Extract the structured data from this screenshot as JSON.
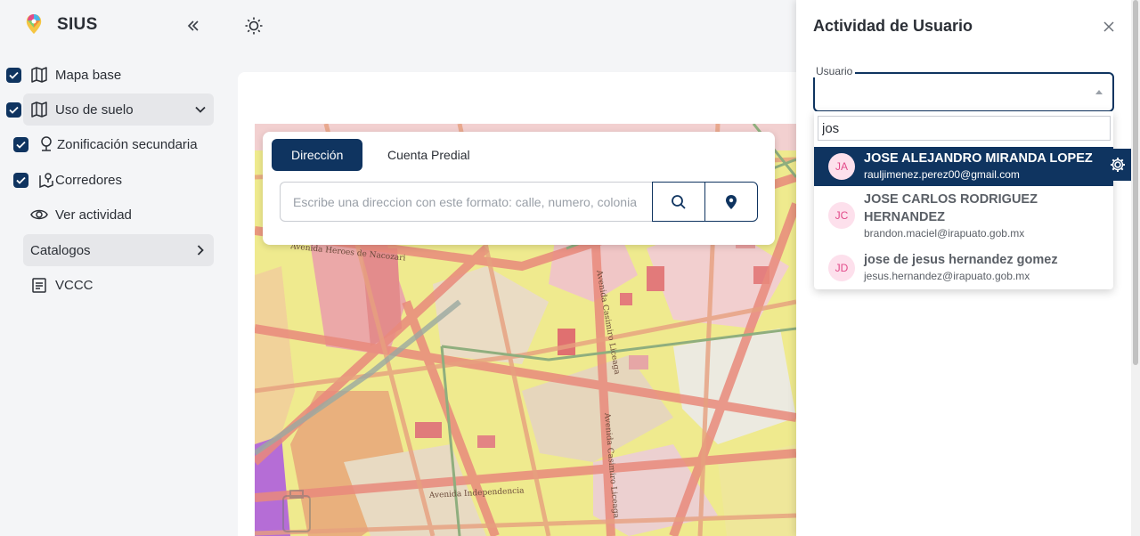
{
  "app": {
    "name": "SIUS"
  },
  "sidebar": {
    "items": [
      {
        "label": "Mapa base",
        "checked": true,
        "icon": "map-outline-icon"
      },
      {
        "label": "Uso de suelo",
        "checked": true,
        "icon": "map-icon",
        "expanded": true
      },
      {
        "label": "Zonificación secundaria",
        "checked": true,
        "icon": "pin-outline-icon"
      },
      {
        "label": "Corredores",
        "checked": true,
        "icon": "map-pin-icon"
      },
      {
        "label": "Ver actividad",
        "icon": "eye-icon"
      },
      {
        "label": "Catalogos",
        "icon": "chevron-right-icon"
      },
      {
        "label": "VCCC",
        "icon": "document-icon"
      }
    ]
  },
  "search": {
    "tabs": [
      {
        "label": "Dirección",
        "active": true
      },
      {
        "label": "Cuenta Predial",
        "active": false
      }
    ],
    "placeholder": "Escribe una direccion con este formato: calle, numero, colonia"
  },
  "map": {
    "street_labels": [
      "Avenida Heroes de Nacozari",
      "Avenida Casimiro Liceaga",
      "Avenida Casimiro Liceaga",
      "Avenida Independencia"
    ]
  },
  "panel": {
    "title": "Actividad de Usuario",
    "field_label": "Usuario",
    "filter_value": "jos",
    "options": [
      {
        "initials": "JA",
        "name": "JOSE ALEJANDRO MIRANDA LOPEZ",
        "email": "rauljimenez.perez00@gmail.com",
        "selected": true
      },
      {
        "initials": "JC",
        "name": "JOSE CARLOS RODRIGUEZ HERNANDEZ",
        "email": "brandon.maciel@irapuato.gob.mx",
        "selected": false
      },
      {
        "initials": "JD",
        "name": "jose de jesus hernandez gomez",
        "email": "jesus.hernandez@irapuato.gob.mx",
        "selected": false
      }
    ]
  },
  "colors": {
    "primary": "#0f3460",
    "avatar_bg": "#fde0ec",
    "avatar_text": "#e24b8a"
  }
}
